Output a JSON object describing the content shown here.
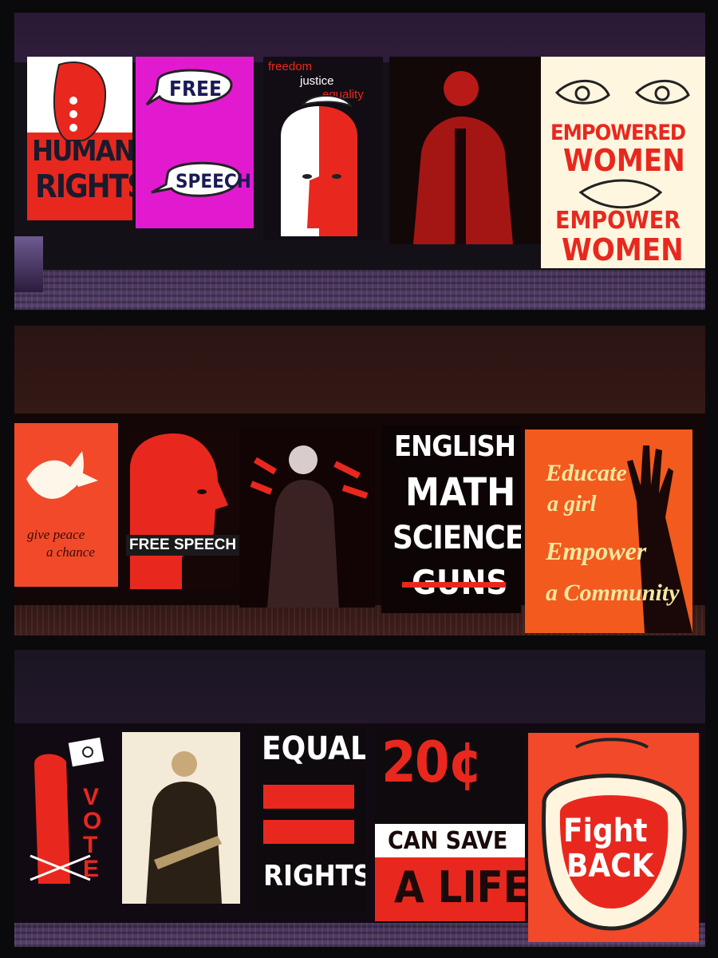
{
  "photo1": {
    "human_rights": [
      "HUMAN",
      "RIGHTS"
    ],
    "free_speech_top": "FREE",
    "free_speech_bottom": "SPEECH",
    "freedom": "freedom",
    "justice": "justice",
    "equality": "equality",
    "empowered_line1": "EMPOWERED",
    "empowered_line2": "WOMEN",
    "empower_line1": "EMPOWER",
    "empower_line2": "WOMEN"
  },
  "photo2": {
    "give_peace_1": "give peace",
    "give_peace_2": "a chance",
    "free_speech": "FREE SPEECH",
    "subjects": [
      "ENGLISH",
      "MATH",
      "SCIENCE",
      "GUNS"
    ],
    "educate": [
      "Educate",
      "a girl",
      "Empower",
      "a Community"
    ]
  },
  "photo3": {
    "vote": "VOTE",
    "equal": "EQUAL",
    "rights": "RIGHTS",
    "cents": "20¢",
    "can_save": "CAN SAVE",
    "a_life": "A LIFE",
    "fight": "Fight",
    "back": "BACK"
  },
  "colors": {
    "red": "#e8281e",
    "magenta": "#e11ad0",
    "cream": "#fff6df",
    "orange": "#f2492a",
    "yellow_text": "#f3e8a0"
  }
}
